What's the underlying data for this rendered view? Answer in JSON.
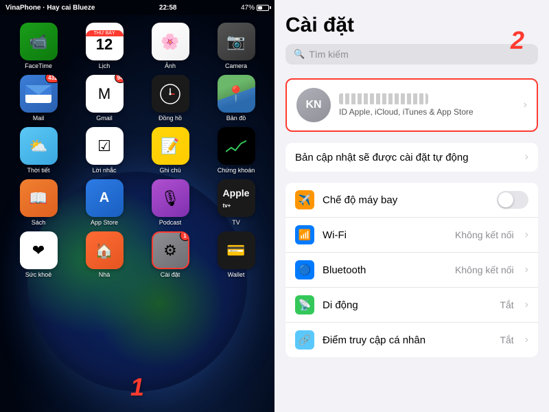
{
  "left": {
    "status": {
      "carrier": "VinaPhone · Hay cai Blueze",
      "time": "22:58",
      "battery": "47%"
    },
    "apps": [
      {
        "id": "facetime",
        "label": "FaceTime",
        "badge": null,
        "icon_type": "facetime",
        "emoji": "📹"
      },
      {
        "id": "calendar",
        "label": "Lịch",
        "badge": null,
        "icon_type": "calendar",
        "emoji": "📅"
      },
      {
        "id": "photos",
        "label": "Ảnh",
        "badge": null,
        "icon_type": "photos",
        "emoji": "🌸"
      },
      {
        "id": "camera",
        "label": "Camera",
        "badge": null,
        "icon_type": "camera",
        "emoji": "📷"
      },
      {
        "id": "mail",
        "label": "Mail",
        "badge": "432",
        "icon_type": "mail",
        "emoji": "✉️"
      },
      {
        "id": "gmail",
        "label": "Gmail",
        "badge": "94",
        "icon_type": "gmail",
        "emoji": "📧"
      },
      {
        "id": "clock",
        "label": "Đồng hồ",
        "badge": null,
        "icon_type": "clock",
        "emoji": "🕙"
      },
      {
        "id": "maps",
        "label": "Bản đồ",
        "badge": null,
        "icon_type": "maps",
        "emoji": "🗺️"
      },
      {
        "id": "weather",
        "label": "Thời tiết",
        "badge": null,
        "icon_type": "weather",
        "emoji": "🌤️"
      },
      {
        "id": "reminders",
        "label": "Lời nhắc",
        "badge": null,
        "icon_type": "reminders",
        "emoji": "📋"
      },
      {
        "id": "notes",
        "label": "Ghi chú",
        "badge": null,
        "icon_type": "notes",
        "emoji": "📝"
      },
      {
        "id": "stocks",
        "label": "Chứng khoán",
        "badge": null,
        "icon_type": "stocks",
        "emoji": "📈"
      },
      {
        "id": "books",
        "label": "Sách",
        "badge": null,
        "icon_type": "books",
        "emoji": "📚"
      },
      {
        "id": "appstore",
        "label": "App Store",
        "badge": null,
        "icon_type": "appstore",
        "emoji": "🅰"
      },
      {
        "id": "podcast",
        "label": "Podcast",
        "badge": null,
        "icon_type": "podcast",
        "emoji": "🎙️"
      },
      {
        "id": "tv",
        "label": "TV",
        "badge": null,
        "icon_type": "tv",
        "emoji": "📺"
      },
      {
        "id": "health",
        "label": "Sức khoẻ",
        "badge": null,
        "icon_type": "health",
        "emoji": "❤️"
      },
      {
        "id": "home",
        "label": "Nhà",
        "badge": null,
        "icon_type": "home",
        "emoji": "🏠"
      },
      {
        "id": "settings",
        "label": "Cài đặt",
        "badge": "1",
        "icon_type": "settings",
        "emoji": "⚙️",
        "highlighted": true
      },
      {
        "id": "wallet",
        "label": "Wallet",
        "badge": null,
        "icon_type": "wallet",
        "emoji": "💳"
      }
    ],
    "number": "1"
  },
  "right": {
    "title": "Cài đặt",
    "number": "2",
    "search_placeholder": "Tìm kiếm",
    "profile": {
      "initials": "KN",
      "name_blurred": true,
      "subtitle": "ID Apple, iCloud, iTunes & App Store"
    },
    "update_row": {
      "label": "Bản cập nhật sẽ được cài đặt tự động"
    },
    "rows": [
      {
        "id": "airplane",
        "label": "Chế độ máy bay",
        "value": "",
        "has_toggle": true,
        "icon_bg": "icon-orange",
        "icon": "✈️"
      },
      {
        "id": "wifi",
        "label": "Wi-Fi",
        "value": "Không kết nối",
        "has_toggle": false,
        "icon_bg": "icon-blue",
        "icon": "📶"
      },
      {
        "id": "bluetooth",
        "label": "Bluetooth",
        "value": "Không kết nối",
        "has_toggle": false,
        "icon_bg": "icon-blue2",
        "icon": "🔵"
      },
      {
        "id": "mobile",
        "label": "Di động",
        "value": "Tắt",
        "has_toggle": false,
        "icon_bg": "icon-green2",
        "icon": "📡"
      },
      {
        "id": "personal-hotspot",
        "label": "Điểm truy cập cá nhân",
        "value": "Tắt",
        "has_toggle": false,
        "icon_bg": "icon-teal",
        "icon": "🔗"
      }
    ]
  }
}
